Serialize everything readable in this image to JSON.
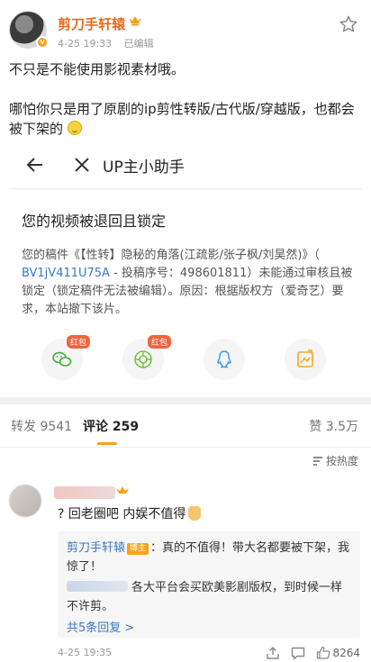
{
  "post": {
    "author": "剪刀手轩辕",
    "date": "4-25 19:33",
    "edited": "已编辑",
    "line1": "不只是不能使用影视素材哦。",
    "line2": "哪怕你只是用了原剧的ip剪性转版/古代版/穿越版，也都会被下架的"
  },
  "card": {
    "nav_title": "UP主小助手",
    "heading": "您的视频被退回且锁定",
    "msg_prefix": "您的稿件《【性转】隐秘的角落(江疏影/张子枫/刘昊然)》（",
    "bv": " BV1jV411U75A",
    "msg_suffix": " - 投稿序号：498601811）未能通过审核且被锁定（锁定稿件无法被编辑）。原因：根据版权方（爱奇艺）要求，本站撤下该片。"
  },
  "share": {
    "red_badge": "红包",
    "items": [
      "wechat-icon",
      "moments-icon",
      "qq-icon",
      "qzone-icon"
    ]
  },
  "tabs": {
    "repost": "转发 9541",
    "comment": "评论 259",
    "likes": "赞 3.5万"
  },
  "sort_label": "按热度",
  "comment": {
    "text": "? 回老圈吧 内娱不值得",
    "reply1_name": "剪刀手轩辕",
    "reply1_badge": "博主",
    "reply1_text": "：真的不值得！带大名都要被下架，我惊了！",
    "reply2_text": "各大平台会买欧美影剧版权，到时候一样不许剪。",
    "more": "共5条回复 >",
    "date": "4-25 19:35",
    "like_count": "8264"
  },
  "colors": {
    "accent": "#f7a21b",
    "author": "#e86a1a",
    "link": "#3a78c3"
  }
}
